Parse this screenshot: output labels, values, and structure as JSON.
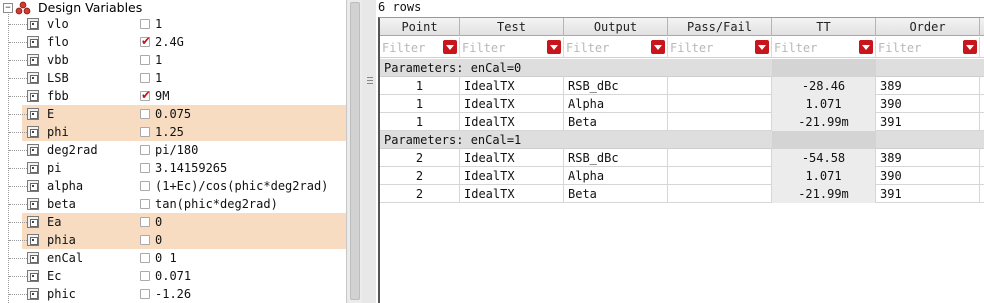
{
  "tree": {
    "title": "Design Variables",
    "expander": "−",
    "variables": [
      {
        "name": "vlo",
        "checked": false,
        "value": "1",
        "highlight": false
      },
      {
        "name": "flo",
        "checked": true,
        "value": "2.4G",
        "highlight": false
      },
      {
        "name": "vbb",
        "checked": false,
        "value": "1",
        "highlight": false
      },
      {
        "name": "LSB",
        "checked": false,
        "value": "1",
        "highlight": false
      },
      {
        "name": "fbb",
        "checked": true,
        "value": "9M",
        "highlight": false
      },
      {
        "name": "E",
        "checked": false,
        "value": "0.075",
        "highlight": true
      },
      {
        "name": "phi",
        "checked": false,
        "value": "1.25",
        "highlight": true
      },
      {
        "name": "deg2rad",
        "checked": false,
        "value": "pi/180",
        "highlight": false
      },
      {
        "name": "pi",
        "checked": false,
        "value": "3.14159265",
        "highlight": false
      },
      {
        "name": "alpha",
        "checked": false,
        "value": "(1+Ec)/cos(phic*deg2rad)",
        "highlight": false
      },
      {
        "name": "beta",
        "checked": false,
        "value": "tan(phic*deg2rad)",
        "highlight": false
      },
      {
        "name": "Ea",
        "checked": false,
        "value": "0",
        "highlight": true
      },
      {
        "name": "phia",
        "checked": false,
        "value": "0",
        "highlight": true
      },
      {
        "name": "enCal",
        "checked": false,
        "value": "0 1",
        "highlight": false
      },
      {
        "name": "Ec",
        "checked": false,
        "value": "0.071",
        "highlight": false
      },
      {
        "name": "phic",
        "checked": false,
        "value": "-1.26",
        "highlight": false
      }
    ],
    "colors": {
      "highlight": "#f7dcc2",
      "checkmark": "#c0161a"
    }
  },
  "results": {
    "row_count": "6 rows",
    "columns": [
      "Point",
      "Test",
      "Output",
      "Pass/Fail",
      "TT",
      "Order"
    ],
    "filter_placeholder": "Filter",
    "groups": [
      {
        "label": "Parameters: enCal=0",
        "rows": [
          {
            "point": "1",
            "test": "IdealTX",
            "output": "RSB_dBc",
            "passfail": "",
            "tt": "-28.46",
            "order": "389"
          },
          {
            "point": "1",
            "test": "IdealTX",
            "output": "Alpha",
            "passfail": "",
            "tt": "1.071",
            "order": "390"
          },
          {
            "point": "1",
            "test": "IdealTX",
            "output": "Beta",
            "passfail": "",
            "tt": "-21.99m",
            "order": "391"
          }
        ]
      },
      {
        "label": "Parameters: enCal=1",
        "rows": [
          {
            "point": "2",
            "test": "IdealTX",
            "output": "RSB_dBc",
            "passfail": "",
            "tt": "-54.58",
            "order": "389"
          },
          {
            "point": "2",
            "test": "IdealTX",
            "output": "Alpha",
            "passfail": "",
            "tt": "1.071",
            "order": "390"
          },
          {
            "point": "2",
            "test": "IdealTX",
            "output": "Beta",
            "passfail": "",
            "tt": "-21.99m",
            "order": "391"
          }
        ]
      }
    ],
    "colors": {
      "filter_button": "#c8141b",
      "group_bg": "#dedede",
      "tt_column_bg": "#ececec"
    }
  }
}
